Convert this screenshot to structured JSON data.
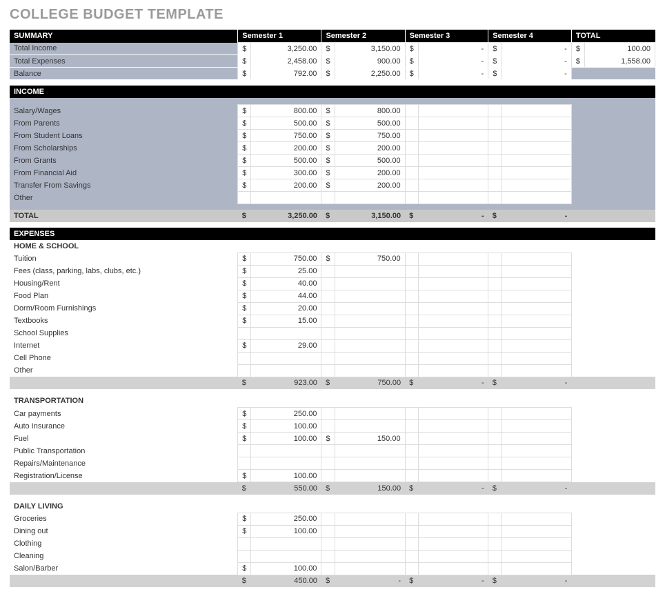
{
  "title": "COLLEGE BUDGET TEMPLATE",
  "headers": {
    "summary": "SUMMARY",
    "sem1": "Semester 1",
    "sem2": "Semester 2",
    "sem3": "Semester 3",
    "sem4": "Semester 4",
    "total": "TOTAL"
  },
  "summary": {
    "rows": [
      {
        "label": "Total Income",
        "s1": "3,250.00",
        "s2": "3,150.00",
        "s3": "-",
        "s4": "-",
        "tot": "100.00"
      },
      {
        "label": "Total Expenses",
        "s1": "2,458.00",
        "s2": "900.00",
        "s3": "-",
        "s4": "-",
        "tot": "1,558.00"
      },
      {
        "label": "Balance",
        "s1": "792.00",
        "s2": "2,250.00",
        "s3": "-",
        "s4": "-",
        "tot": ""
      }
    ]
  },
  "income": {
    "header": "INCOME",
    "rows": [
      {
        "label": "Salary/Wages",
        "s1": "800.00",
        "s2": "800.00"
      },
      {
        "label": "From Parents",
        "s1": "500.00",
        "s2": "500.00"
      },
      {
        "label": "From Student Loans",
        "s1": "750.00",
        "s2": "750.00"
      },
      {
        "label": "From Scholarships",
        "s1": "200.00",
        "s2": "200.00"
      },
      {
        "label": "From Grants",
        "s1": "500.00",
        "s2": "500.00"
      },
      {
        "label": "From Financial Aid",
        "s1": "300.00",
        "s2": "200.00"
      },
      {
        "label": "Transfer From Savings",
        "s1": "200.00",
        "s2": "200.00"
      },
      {
        "label": "Other",
        "s1": "",
        "s2": ""
      }
    ],
    "total": {
      "label": "TOTAL",
      "s1": "3,250.00",
      "s2": "3,150.00",
      "s3": "-",
      "s4": "-"
    }
  },
  "expenses": {
    "header": "EXPENSES",
    "groups": [
      {
        "name": "HOME & SCHOOL",
        "rows": [
          {
            "label": "Tuition",
            "s1": "750.00",
            "s2": "750.00"
          },
          {
            "label": "Fees (class, parking, labs, clubs, etc.)",
            "s1": "25.00"
          },
          {
            "label": "Housing/Rent",
            "s1": "40.00"
          },
          {
            "label": "Food Plan",
            "s1": "44.00"
          },
          {
            "label": "Dorm/Room Furnishings",
            "s1": "20.00"
          },
          {
            "label": "Textbooks",
            "s1": "15.00"
          },
          {
            "label": "School Supplies"
          },
          {
            "label": "Internet",
            "s1": "29.00"
          },
          {
            "label": "Cell Phone"
          },
          {
            "label": "Other"
          }
        ],
        "subtotal": {
          "s1": "923.00",
          "s2": "750.00",
          "s3": "-",
          "s4": "-"
        }
      },
      {
        "name": "TRANSPORTATION",
        "rows": [
          {
            "label": "Car payments",
            "s1": "250.00"
          },
          {
            "label": "Auto Insurance",
            "s1": "100.00"
          },
          {
            "label": "Fuel",
            "s1": "100.00",
            "s2": "150.00"
          },
          {
            "label": "Public Transportation"
          },
          {
            "label": "Repairs/Maintenance"
          },
          {
            "label": "Registration/License",
            "s1": "100.00"
          }
        ],
        "subtotal": {
          "s1": "550.00",
          "s2": "150.00",
          "s3": "-",
          "s4": "-"
        }
      },
      {
        "name": "DAILY LIVING",
        "rows": [
          {
            "label": "Groceries",
            "s1": "250.00"
          },
          {
            "label": "Dining out",
            "s1": "100.00"
          },
          {
            "label": "Clothing"
          },
          {
            "label": "Cleaning"
          },
          {
            "label": "Salon/Barber",
            "s1": "100.00"
          }
        ],
        "subtotal": {
          "s1": "450.00",
          "s2": "-",
          "s3": "-",
          "s4": "-"
        }
      }
    ]
  },
  "cur": "$"
}
